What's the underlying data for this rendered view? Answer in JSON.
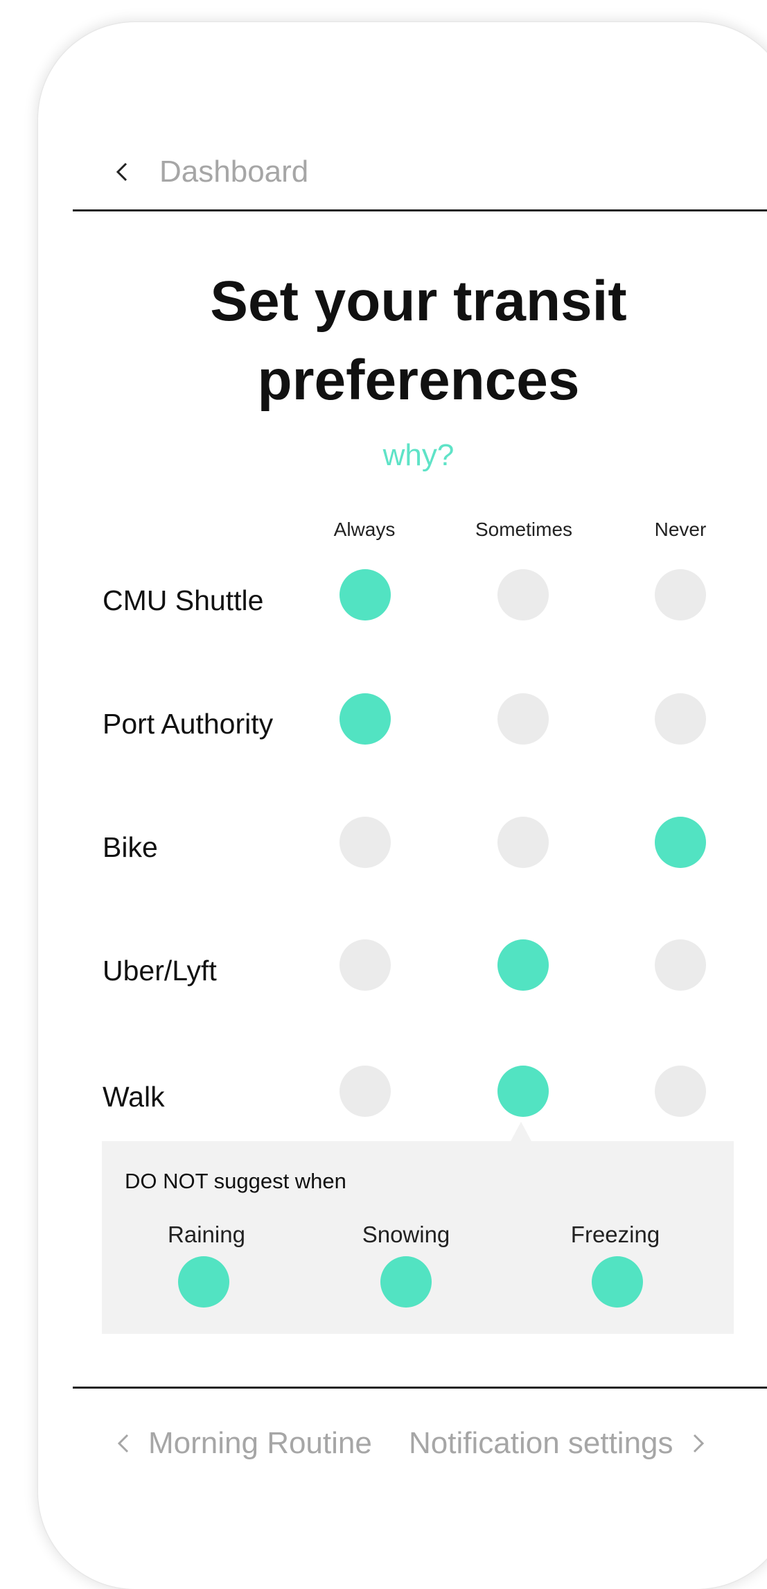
{
  "header": {
    "back_label": "Dashboard",
    "back_icon": "chevron-left-icon"
  },
  "title": "Set your transit preferences",
  "why_link": "why?",
  "colors": {
    "accent": "#52e3c2",
    "link": "#5fe3c7",
    "inactive_dot": "#ebebeb",
    "muted_text": "#a6a6a6",
    "panel_bg": "#f2f2f2"
  },
  "columns": [
    "Always",
    "Sometimes",
    "Never"
  ],
  "rows": [
    {
      "label": "CMU Shuttle",
      "selected": "Always"
    },
    {
      "label": "Port Authority",
      "selected": "Always"
    },
    {
      "label": "Bike",
      "selected": "Never"
    },
    {
      "label": "Uber/Lyft",
      "selected": "Sometimes"
    },
    {
      "label": "Walk",
      "selected": "Sometimes"
    }
  ],
  "walk_conditions": {
    "title": "DO NOT suggest when",
    "items": [
      {
        "label": "Raining",
        "selected": true
      },
      {
        "label": "Snowing",
        "selected": true
      },
      {
        "label": "Freezing",
        "selected": true
      }
    ]
  },
  "footer": {
    "prev_label": "Morning Routine",
    "next_label": "Notification settings",
    "prev_icon": "chevron-left-icon",
    "next_icon": "chevron-right-icon"
  }
}
